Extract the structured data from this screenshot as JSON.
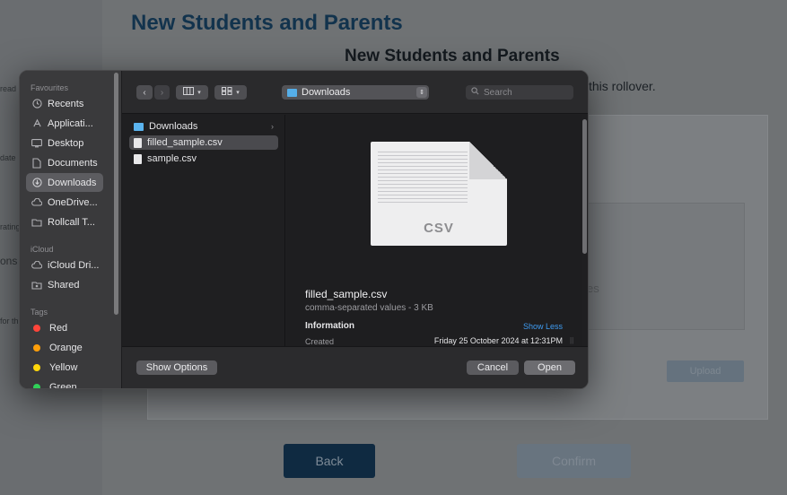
{
  "background_page": {
    "title": "New Students and Parents",
    "subtitle": "New Students and Parents",
    "description_fragment": "this rollover.",
    "left_fragments": [
      "read",
      "date",
      "rating",
      "ons",
      "for th"
    ],
    "drop_zone_fragment": "es",
    "upload_label": "Upload",
    "back_label": "Back",
    "confirm_label": "Confirm"
  },
  "dialog": {
    "sidebar": {
      "favourites_header": "Favourites",
      "favourites": [
        {
          "label": "Recents",
          "icon": "clock-icon"
        },
        {
          "label": "Applicati...",
          "icon": "applications-icon"
        },
        {
          "label": "Desktop",
          "icon": "desktop-icon"
        },
        {
          "label": "Documents",
          "icon": "document-icon"
        },
        {
          "label": "Downloads",
          "icon": "download-icon",
          "selected": true
        },
        {
          "label": "OneDrive...",
          "icon": "cloud-icon"
        },
        {
          "label": "Rollcall T...",
          "icon": "folder-icon"
        }
      ],
      "icloud_header": "iCloud",
      "icloud": [
        {
          "label": "iCloud Dri...",
          "icon": "cloud-icon"
        },
        {
          "label": "Shared",
          "icon": "shared-folder-icon"
        }
      ],
      "tags_header": "Tags",
      "tags": [
        {
          "label": "Red",
          "color": "#ff453a"
        },
        {
          "label": "Orange",
          "color": "#ff9f0a"
        },
        {
          "label": "Yellow",
          "color": "#ffd60a"
        },
        {
          "label": "Green",
          "color": "#30d158"
        }
      ]
    },
    "toolbar": {
      "location": "Downloads",
      "search_placeholder": "Search"
    },
    "files": [
      {
        "name": "Downloads",
        "type": "folder",
        "has_chevron": true
      },
      {
        "name": "filled_sample.csv",
        "type": "file",
        "selected": true
      },
      {
        "name": "sample.csv",
        "type": "file"
      }
    ],
    "preview": {
      "thumbnail_label": "CSV",
      "filename": "filled_sample.csv",
      "kind": "comma-separated values - 3 KB",
      "info_header": "Information",
      "show_less": "Show Less",
      "created_label": "Created",
      "created_value": "Friday 25 October 2024 at 12:31PM"
    },
    "footer": {
      "show_options": "Show Options",
      "cancel": "Cancel",
      "open": "Open"
    }
  }
}
